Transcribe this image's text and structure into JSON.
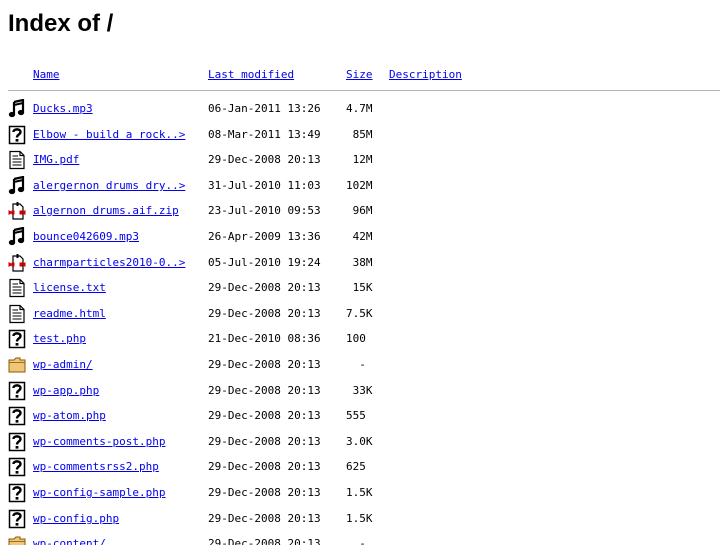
{
  "page": {
    "title": "Index of /"
  },
  "columns": {
    "name": "Name",
    "last_modified": "Last modified",
    "size": "Size",
    "description": "Description"
  },
  "rows": [
    {
      "icon": "sound-icon",
      "name": "Ducks.mp3",
      "modified": "06-Jan-2011 13:26",
      "size": "4.7M"
    },
    {
      "icon": "unknown-icon",
      "name": "Elbow - build a rock..>",
      "modified": "08-Mar-2011 13:49",
      "size": " 85M"
    },
    {
      "icon": "text-icon",
      "name": "IMG.pdf",
      "modified": "29-Dec-2008 20:13",
      "size": " 12M"
    },
    {
      "icon": "sound-icon",
      "name": "alergernon drums dry..>",
      "modified": "31-Jul-2010 11:03",
      "size": "102M"
    },
    {
      "icon": "compressed-icon",
      "name": "algernon drums.aif.zip",
      "modified": "23-Jul-2010 09:53",
      "size": " 96M"
    },
    {
      "icon": "sound-icon",
      "name": "bounce042609.mp3",
      "modified": "26-Apr-2009 13:36",
      "size": " 42M"
    },
    {
      "icon": "compressed-icon",
      "name": "charmparticles2010-0..>",
      "modified": "05-Jul-2010 19:24",
      "size": " 38M"
    },
    {
      "icon": "text-icon",
      "name": "license.txt",
      "modified": "29-Dec-2008 20:13",
      "size": " 15K"
    },
    {
      "icon": "text-icon",
      "name": "readme.html",
      "modified": "29-Dec-2008 20:13",
      "size": "7.5K"
    },
    {
      "icon": "unknown-icon",
      "name": "test.php",
      "modified": "21-Dec-2010 08:36",
      "size": "100 "
    },
    {
      "icon": "folder-icon",
      "name": "wp-admin/",
      "modified": "29-Dec-2008 20:13",
      "size": "  - "
    },
    {
      "icon": "unknown-icon",
      "name": "wp-app.php",
      "modified": "29-Dec-2008 20:13",
      "size": " 33K"
    },
    {
      "icon": "unknown-icon",
      "name": "wp-atom.php",
      "modified": "29-Dec-2008 20:13",
      "size": "555 "
    },
    {
      "icon": "unknown-icon",
      "name": "wp-comments-post.php",
      "modified": "29-Dec-2008 20:13",
      "size": "3.0K"
    },
    {
      "icon": "unknown-icon",
      "name": "wp-commentsrss2.php",
      "modified": "29-Dec-2008 20:13",
      "size": "625 "
    },
    {
      "icon": "unknown-icon",
      "name": "wp-config-sample.php",
      "modified": "29-Dec-2008 20:13",
      "size": "1.5K"
    },
    {
      "icon": "unknown-icon",
      "name": "wp-config.php",
      "modified": "29-Dec-2008 20:13",
      "size": "1.5K"
    },
    {
      "icon": "folder-icon",
      "name": "wp-content/",
      "modified": "29-Dec-2008 20:13",
      "size": "  - "
    }
  ],
  "colors": {
    "link": "#0000ee",
    "rule": "#b3b3b3",
    "folder": "#f0c77a",
    "compressed_red": "#d40000"
  }
}
